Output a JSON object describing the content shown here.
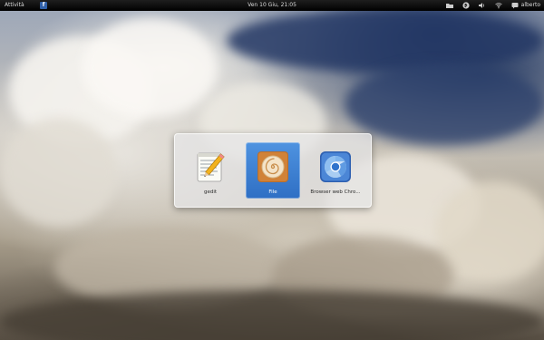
{
  "topbar": {
    "activities_label": "Attività",
    "app_indicator_glyph": "f",
    "clock": "Ven 10 Giu, 21:05",
    "username": "alberto"
  },
  "switcher": {
    "apps": [
      {
        "label": "gedit",
        "icon": "text-editor-icon",
        "selected": false
      },
      {
        "label": "File",
        "icon": "files-nautilus-icon",
        "selected": true
      },
      {
        "label": "Browser web Chro...",
        "icon": "chromium-browser-icon",
        "selected": false
      }
    ]
  },
  "colors": {
    "topbar": "#000000",
    "selection": "#3a7fd5"
  }
}
